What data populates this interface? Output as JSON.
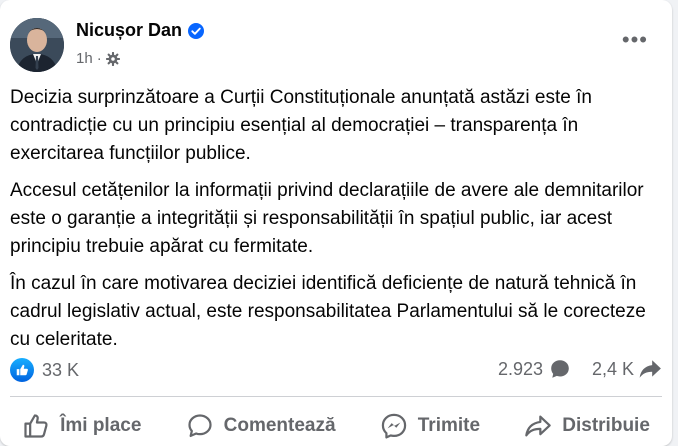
{
  "post": {
    "author": "Nicușor Dan",
    "time": "1h",
    "more_label": "•••",
    "paragraphs": [
      "Decizia surprinzătoare a Curții Constituționale anunțată astăzi este în contradicție cu un principiu esențial al democrației – transparența în exercitarea funcțiilor publice.",
      "Accesul cetățenilor la informații privind declarațiile de avere ale demnitarilor este o garanție a integrității și responsabilității în spațiul public, iar acest principiu trebuie apărat cu fermitate.",
      "În cazul în care motivarea deciziei identifică deficiențe de natură tehnică în cadrul legislativ actual, este responsabilitatea Parlamentului să le corecteze cu celeritate."
    ]
  },
  "stats": {
    "likes": "33 K",
    "comments": "2.923",
    "shares": "2,4 K"
  },
  "actions": {
    "like": "Îmi place",
    "comment": "Comentează",
    "send": "Trimite",
    "share": "Distribuie"
  },
  "colors": {
    "accent": "#0866ff",
    "muted": "#65676b"
  },
  "icons": {
    "verified": "verified-badge-icon",
    "audience": "gear-icon",
    "like": "thumbs-up-icon",
    "comment": "speech-bubble-icon",
    "send": "messenger-icon",
    "share": "share-arrow-icon"
  }
}
